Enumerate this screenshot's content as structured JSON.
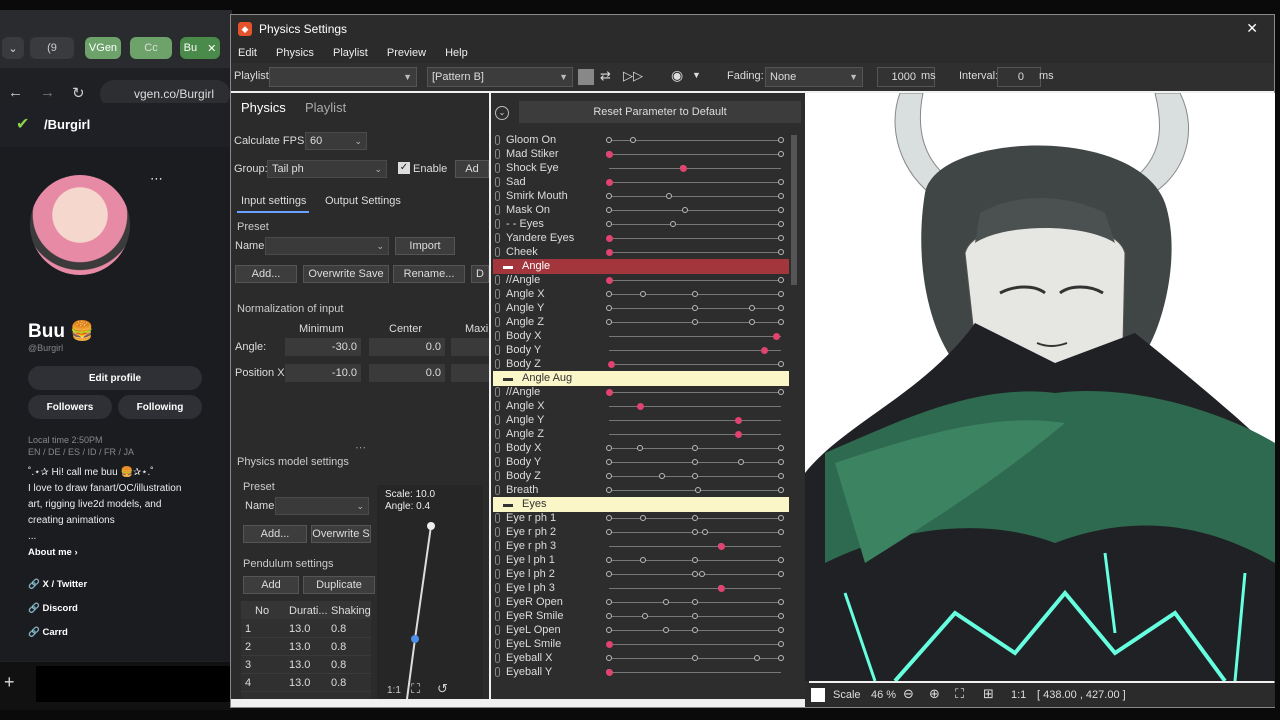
{
  "browser": {
    "tabs": [
      "(9",
      "VGen",
      "Cc",
      "Bu"
    ],
    "url": "vgen.co/Burgirl"
  },
  "site": {
    "handle": "/Burgirl",
    "name": "Buu 🍔",
    "username": "@Burgirl",
    "edit_profile": "Edit profile",
    "followers": "Followers",
    "following": "Following",
    "local_time": "Local time 2:50PM",
    "languages": "EN / DE / ES / ID / FR / JA",
    "bio": [
      "˚.⋆✰ Hi! call me buu 🍔✰⋆.˚",
      "I love to draw fanart/OC/illustration",
      "art, rigging live2d models, and",
      "creating animations",
      "..."
    ],
    "about_me": "About me ›",
    "links": [
      "X / Twitter",
      "Discord",
      "Carrd"
    ]
  },
  "window": {
    "title": "Physics Settings",
    "menu": [
      "Edit",
      "Physics",
      "Playlist",
      "Preview",
      "Help"
    ],
    "toolbar": {
      "playlist_label": "Playlist:",
      "pattern": "[Pattern B]",
      "fading_label": "Fading:",
      "fading_value": "None",
      "duration": "1000",
      "duration_unit": "ms",
      "interval_label": "Interval:",
      "interval_value": "0",
      "interval_unit": "ms"
    },
    "left": {
      "tabs": [
        "Physics",
        "Playlist"
      ],
      "fps_label": "Calculate FPS:",
      "fps_value": "60",
      "group_label": "Group:",
      "group_value": "Tail ph",
      "enable_label": "Enable",
      "add_trunc": "Ad",
      "subtabs": [
        "Input settings",
        "Output Settings"
      ],
      "preset_label": "Preset",
      "name_label": "Name:",
      "import": "Import",
      "add": "Add...",
      "overwrite_save": "Overwrite Save",
      "rename": "Rename...",
      "delete_trunc": "D",
      "norm_title": "Normalization of input",
      "col_min": "Minimum",
      "col_center": "Center",
      "col_max": "Maxi",
      "angle_label": "Angle:",
      "angle_min": "-30.0",
      "angle_center": "0.0",
      "posx_label": "Position X:",
      "posx_min": "-10.0",
      "posx_center": "0.0",
      "model_title": "Physics model settings",
      "m_preset": "Preset",
      "m_name": "Name:",
      "m_add": "Add...",
      "m_overwrite": "Overwrite S",
      "pendulum": "Pendulum settings",
      "p_add": "Add",
      "p_dup": "Duplicate",
      "table_headers": [
        "No",
        "Durati...",
        "Shaking"
      ],
      "table_rows": [
        [
          "1",
          "13.0",
          "0.8"
        ],
        [
          "2",
          "13.0",
          "0.8"
        ],
        [
          "3",
          "13.0",
          "0.8"
        ],
        [
          "4",
          "13.0",
          "0.8"
        ]
      ],
      "scale_text": "Scale: 10.0",
      "angle_text": "Angle: 0.4",
      "one_to_one": "1:1"
    },
    "reset_btn": "Reset Parameter to Default",
    "params": [
      {
        "name": "Gloom On",
        "dots": [
          0,
          0.14,
          1
        ]
      },
      {
        "name": "Mad Stiker",
        "dots": [
          0,
          1
        ],
        "red": 0
      },
      {
        "name": "Shock Eye",
        "dots": [
          0.43
        ],
        "red": 0.43,
        "line": true
      },
      {
        "name": "Sad",
        "dots": [
          1
        ],
        "red": 0
      },
      {
        "name": "Smirk Mouth",
        "dots": [
          0,
          0.35,
          1
        ]
      },
      {
        "name": "Mask On",
        "dots": [
          0,
          0.44,
          1
        ]
      },
      {
        "name": "- - Eyes",
        "dots": [
          0,
          0.37,
          1
        ]
      },
      {
        "name": "Yandere Eyes",
        "dots": [
          1
        ],
        "red": 0
      },
      {
        "name": "Cheek",
        "dots": [
          1
        ],
        "red": 0
      },
      {
        "group": "Angle",
        "style": "red"
      },
      {
        "name": "//Angle",
        "dots": [
          1
        ],
        "red": 0
      },
      {
        "name": "Angle X",
        "dots": [
          0,
          0.2,
          0.5,
          1
        ]
      },
      {
        "name": "Angle Y",
        "dots": [
          0,
          0.5,
          0.83,
          1
        ]
      },
      {
        "name": "Angle Z",
        "dots": [
          0,
          0.5,
          0.83,
          1
        ]
      },
      {
        "name": "Body X",
        "dots": [],
        "red": 0.97,
        "line": true
      },
      {
        "name": "Body Y",
        "dots": [],
        "red": 0.9,
        "line": true
      },
      {
        "name": "Body Z",
        "dots": [
          1
        ],
        "red": 0.01
      },
      {
        "group": "Angle Aug",
        "style": "yellow"
      },
      {
        "name": "//Angle",
        "dots": [
          1
        ],
        "red": 0
      },
      {
        "name": "Angle X",
        "dots": [],
        "red": 0.18,
        "line": true
      },
      {
        "name": "Angle Y",
        "dots": [],
        "red": 0.75,
        "line": true
      },
      {
        "name": "Angle Z",
        "dots": [],
        "red": 0.75,
        "line": true
      },
      {
        "name": "Body X",
        "dots": [
          0,
          0.18,
          0.5,
          1
        ]
      },
      {
        "name": "Body Y",
        "dots": [
          0,
          0.5,
          0.77,
          1
        ]
      },
      {
        "name": "Body Z",
        "dots": [
          0,
          0.31,
          0.5,
          1
        ]
      },
      {
        "name": "Breath",
        "dots": [
          0,
          0.52,
          1
        ]
      },
      {
        "group": "Eyes",
        "style": "yellow"
      },
      {
        "name": "Eye r ph 1",
        "dots": [
          0,
          0.2,
          0.5,
          1
        ]
      },
      {
        "name": "Eye r ph 2",
        "dots": [
          0,
          0.5,
          0.56,
          1
        ]
      },
      {
        "name": "Eye r ph 3",
        "dots": [
          0.65
        ],
        "red": 0.65,
        "line": true
      },
      {
        "name": "Eye l ph 1",
        "dots": [
          0,
          0.2,
          0.5,
          1
        ]
      },
      {
        "name": "Eye l ph 2",
        "dots": [
          0,
          0.5,
          0.54,
          1
        ]
      },
      {
        "name": "Eye l ph 3",
        "dots": [
          0.65
        ],
        "red": 0.65,
        "line": true
      },
      {
        "name": "EyeR Open",
        "dots": [
          0,
          0.33,
          0.5,
          1
        ]
      },
      {
        "name": "EyeR Smile",
        "dots": [
          0,
          0.21,
          0.5,
          1
        ]
      },
      {
        "name": "EyeL Open",
        "dots": [
          0,
          0.33,
          0.5,
          1
        ]
      },
      {
        "name": "EyeL Smile",
        "dots": [
          1
        ],
        "red": 0
      },
      {
        "name": "Eyeball X",
        "dots": [
          0,
          0.5,
          0.86,
          1
        ]
      },
      {
        "name": "Eyeball Y",
        "dots": [
          0
        ],
        "red": 0
      }
    ],
    "status": {
      "scale_label": "Scale",
      "scale_value": "46 %",
      "ratio": "1:1",
      "coords": "[ 438.00 , 427.00 ]"
    }
  }
}
